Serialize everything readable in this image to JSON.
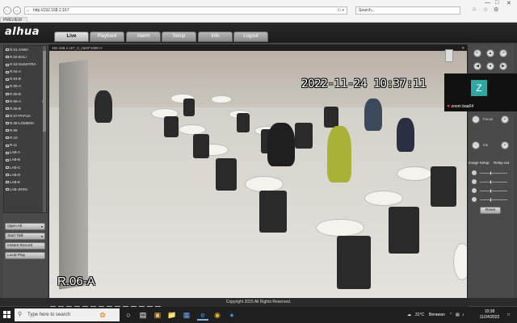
{
  "browser": {
    "url": "http://192.168.2.167",
    "search_placeholder": "Search...",
    "tab_label": "PREVIEW"
  },
  "app": {
    "brand": "alhua",
    "nav_tabs": [
      "Live",
      "Playback",
      "Alarm",
      "Setup",
      "Info",
      "Logout"
    ],
    "active_tab": "Live"
  },
  "channels": [
    "R.01-JAWA",
    "R.02-BALI",
    "R.03-SUMATRA",
    "R.04-A",
    "R.04-B",
    "R.05-A",
    "R.05-B",
    "R.06-A",
    "R.06-B",
    "R.07-PAPUA",
    "R.08-LOMBOK",
    "R.09",
    "R.10",
    "R.11",
    "LAB-A",
    "LAB-B",
    "LAB-C",
    "LAB-D",
    "LAB-E",
    "LAB-JRSN"
  ],
  "left_buttons": {
    "open_all": "Open All",
    "start_talk": "Start Talk",
    "instant_record": "Instant Record",
    "local_play": "Local Play"
  },
  "video": {
    "header_text": "192.168.2.167_0_1920*1080  H",
    "timestamp": "2022-11-24 10:37:11",
    "room_label": "R.06-A"
  },
  "ptz": {
    "zoom": "Zoom",
    "focus": "Focus",
    "iris": "Iris",
    "image_setup": "Image Setup",
    "relay_out": "Relay-out",
    "reset": "Reset"
  },
  "zoom_overlay": {
    "initial": "Z",
    "name": "zoom baa04"
  },
  "footer": {
    "copyright": "Copyright 2015 All Rights Reserved."
  },
  "taskbar": {
    "search_placeholder": "Type here to search",
    "temperature": "31°C",
    "weather": "Berawan",
    "time": "10:38",
    "date": "11/24/2022"
  },
  "colors": {
    "zoom_tile": "#2fa6a0",
    "taskbar_bg": "#1f1f1f"
  }
}
